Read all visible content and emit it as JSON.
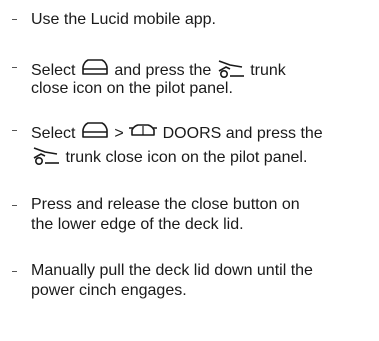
{
  "instructions": [
    {
      "text": "Use the Lucid mobile app."
    },
    {
      "select_label": "Select",
      "and_press_label": "and press the",
      "trunk_label": "trunk",
      "line2": "close icon on the pilot panel.",
      "icons": [
        "vehicle-icon",
        "trunk-close-icon"
      ]
    },
    {
      "select_label": "Select",
      "separator": ">",
      "doors_label": "DOORS and press the",
      "line2": "trunk close icon on the pilot panel.",
      "icons": [
        "vehicle-icon",
        "doors-icon",
        "trunk-close-icon"
      ]
    },
    {
      "line1": "Press and release the close button on",
      "line2": "the lower edge of the deck lid."
    },
    {
      "line1": "Manually pull the deck lid down until the",
      "line2": "power cinch engages."
    }
  ]
}
